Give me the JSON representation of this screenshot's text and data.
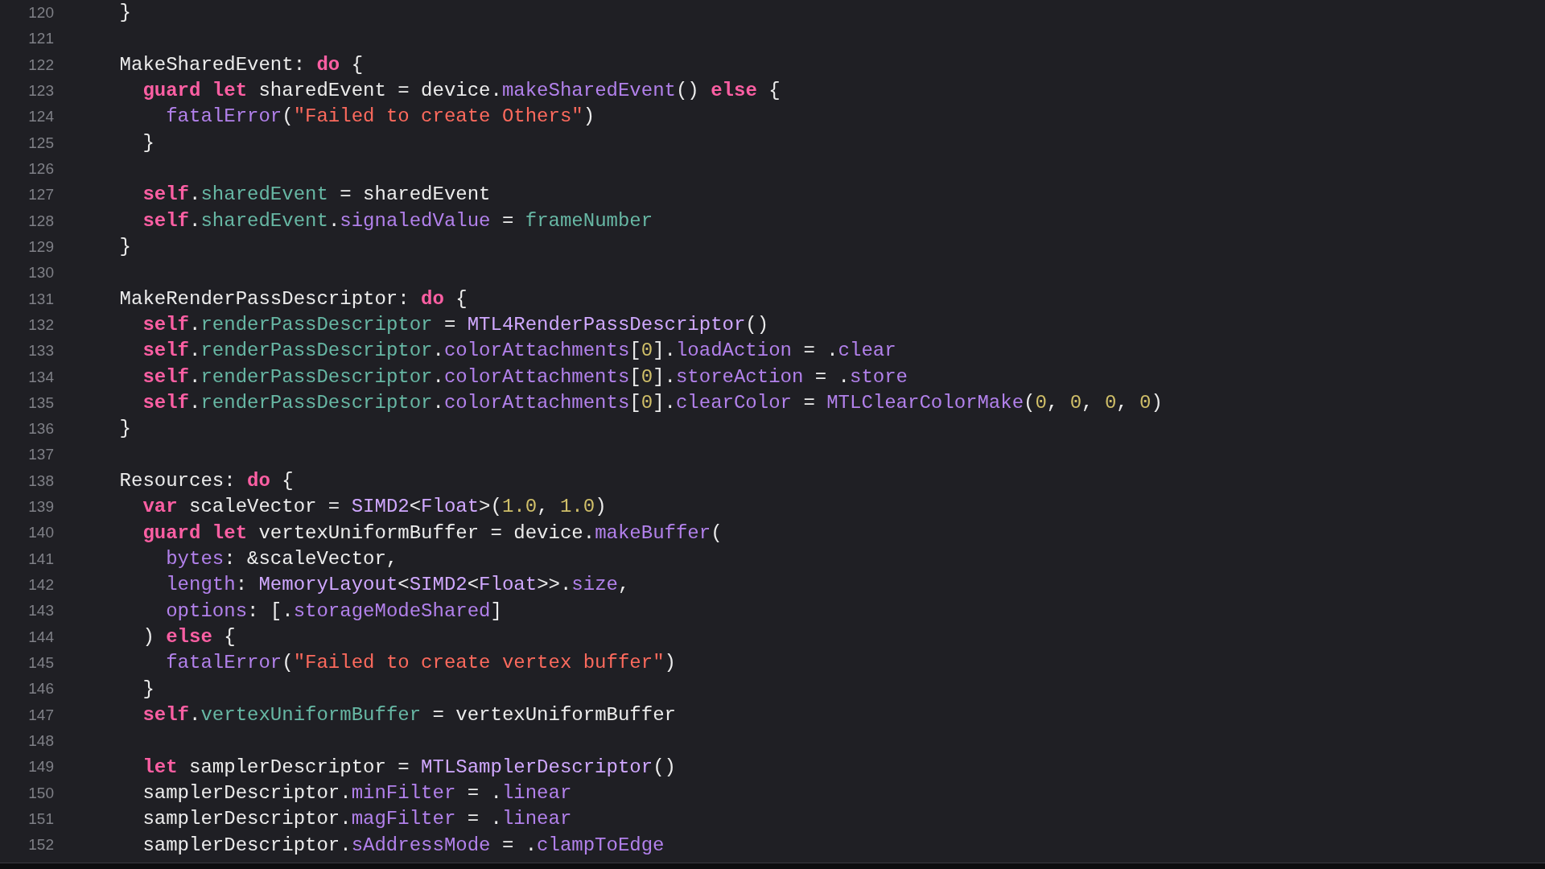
{
  "editor": {
    "lines": [
      {
        "number": "120",
        "tokens": [
          {
            "text": "    }",
            "kind": "plain"
          }
        ]
      },
      {
        "number": "121"
      },
      {
        "number": "122",
        "tokens": [
          {
            "text": "    MakeSharedEvent: ",
            "kind": "plain"
          },
          {
            "text": "do",
            "kind": "keyword"
          },
          {
            "text": " {",
            "kind": "plain"
          }
        ]
      },
      {
        "number": "123",
        "tokens": [
          {
            "text": "      guard let",
            "kind": "keyword"
          },
          {
            "text": " sharedEvent = device.",
            "kind": "plain"
          },
          {
            "text": "makeSharedEvent",
            "kind": "method"
          },
          {
            "text": "() ",
            "kind": "plain"
          },
          {
            "text": "else",
            "kind": "keyword"
          },
          {
            "text": " {",
            "kind": "plain"
          }
        ]
      },
      {
        "number": "124",
        "tokens": [
          {
            "text": "        fatalError",
            "kind": "method"
          },
          {
            "text": "(",
            "kind": "plain"
          },
          {
            "text": "\"Failed to create Others\"",
            "kind": "string"
          },
          {
            "text": ")",
            "kind": "plain"
          }
        ]
      },
      {
        "number": "125",
        "tokens": [
          {
            "text": "      }",
            "kind": "plain"
          }
        ]
      },
      {
        "number": "126"
      },
      {
        "number": "127",
        "tokens": [
          {
            "text": "      self",
            "kind": "keyword"
          },
          {
            "text": ".",
            "kind": "plain"
          },
          {
            "text": "sharedEvent",
            "kind": "project"
          },
          {
            "text": " = sharedEvent",
            "kind": "plain"
          }
        ]
      },
      {
        "number": "128",
        "tokens": [
          {
            "text": "      self",
            "kind": "keyword"
          },
          {
            "text": ".",
            "kind": "plain"
          },
          {
            "text": "sharedEvent",
            "kind": "project"
          },
          {
            "text": ".",
            "kind": "plain"
          },
          {
            "text": "signaledValue",
            "kind": "method"
          },
          {
            "text": " = ",
            "kind": "plain"
          },
          {
            "text": "frameNumber",
            "kind": "project"
          }
        ]
      },
      {
        "number": "129",
        "tokens": [
          {
            "text": "    }",
            "kind": "plain"
          }
        ]
      },
      {
        "number": "130"
      },
      {
        "number": "131",
        "tokens": [
          {
            "text": "    MakeRenderPassDescriptor: ",
            "kind": "plain"
          },
          {
            "text": "do",
            "kind": "keyword"
          },
          {
            "text": " {",
            "kind": "plain"
          }
        ]
      },
      {
        "number": "132",
        "tokens": [
          {
            "text": "      self",
            "kind": "keyword"
          },
          {
            "text": ".",
            "kind": "plain"
          },
          {
            "text": "renderPassDescriptor",
            "kind": "project"
          },
          {
            "text": " = ",
            "kind": "plain"
          },
          {
            "text": "MTL4RenderPassDescriptor",
            "kind": "type"
          },
          {
            "text": "()",
            "kind": "plain"
          }
        ]
      },
      {
        "number": "133",
        "tokens": [
          {
            "text": "      self",
            "kind": "keyword"
          },
          {
            "text": ".",
            "kind": "plain"
          },
          {
            "text": "renderPassDescriptor",
            "kind": "project"
          },
          {
            "text": ".",
            "kind": "plain"
          },
          {
            "text": "colorAttachments",
            "kind": "method"
          },
          {
            "text": "[",
            "kind": "plain"
          },
          {
            "text": "0",
            "kind": "number"
          },
          {
            "text": "].",
            "kind": "plain"
          },
          {
            "text": "loadAction",
            "kind": "method"
          },
          {
            "text": " = .",
            "kind": "plain"
          },
          {
            "text": "clear",
            "kind": "method"
          }
        ]
      },
      {
        "number": "134",
        "tokens": [
          {
            "text": "      self",
            "kind": "keyword"
          },
          {
            "text": ".",
            "kind": "plain"
          },
          {
            "text": "renderPassDescriptor",
            "kind": "project"
          },
          {
            "text": ".",
            "kind": "plain"
          },
          {
            "text": "colorAttachments",
            "kind": "method"
          },
          {
            "text": "[",
            "kind": "plain"
          },
          {
            "text": "0",
            "kind": "number"
          },
          {
            "text": "].",
            "kind": "plain"
          },
          {
            "text": "storeAction",
            "kind": "method"
          },
          {
            "text": " = .",
            "kind": "plain"
          },
          {
            "text": "store",
            "kind": "method"
          }
        ]
      },
      {
        "number": "135",
        "tokens": [
          {
            "text": "      self",
            "kind": "keyword"
          },
          {
            "text": ".",
            "kind": "plain"
          },
          {
            "text": "renderPassDescriptor",
            "kind": "project"
          },
          {
            "text": ".",
            "kind": "plain"
          },
          {
            "text": "colorAttachments",
            "kind": "method"
          },
          {
            "text": "[",
            "kind": "plain"
          },
          {
            "text": "0",
            "kind": "number"
          },
          {
            "text": "].",
            "kind": "plain"
          },
          {
            "text": "clearColor",
            "kind": "method"
          },
          {
            "text": " = ",
            "kind": "plain"
          },
          {
            "text": "MTLClearColorMake",
            "kind": "method"
          },
          {
            "text": "(",
            "kind": "plain"
          },
          {
            "text": "0",
            "kind": "number"
          },
          {
            "text": ", ",
            "kind": "plain"
          },
          {
            "text": "0",
            "kind": "number"
          },
          {
            "text": ", ",
            "kind": "plain"
          },
          {
            "text": "0",
            "kind": "number"
          },
          {
            "text": ", ",
            "kind": "plain"
          },
          {
            "text": "0",
            "kind": "number"
          },
          {
            "text": ")",
            "kind": "plain"
          }
        ]
      },
      {
        "number": "136",
        "tokens": [
          {
            "text": "    }",
            "kind": "plain"
          }
        ]
      },
      {
        "number": "137"
      },
      {
        "number": "138",
        "tokens": [
          {
            "text": "    Resources: ",
            "kind": "plain"
          },
          {
            "text": "do",
            "kind": "keyword"
          },
          {
            "text": " {",
            "kind": "plain"
          }
        ]
      },
      {
        "number": "139",
        "tokens": [
          {
            "text": "      var",
            "kind": "keyword"
          },
          {
            "text": " scaleVector = ",
            "kind": "plain"
          },
          {
            "text": "SIMD2",
            "kind": "type"
          },
          {
            "text": "<",
            "kind": "plain"
          },
          {
            "text": "Float",
            "kind": "type"
          },
          {
            "text": ">(",
            "kind": "plain"
          },
          {
            "text": "1.0",
            "kind": "number"
          },
          {
            "text": ", ",
            "kind": "plain"
          },
          {
            "text": "1.0",
            "kind": "number"
          },
          {
            "text": ")",
            "kind": "plain"
          }
        ]
      },
      {
        "number": "140",
        "tokens": [
          {
            "text": "      guard let",
            "kind": "keyword"
          },
          {
            "text": " vertexUniformBuffer = device.",
            "kind": "plain"
          },
          {
            "text": "makeBuffer",
            "kind": "method"
          },
          {
            "text": "(",
            "kind": "plain"
          }
        ]
      },
      {
        "number": "141",
        "tokens": [
          {
            "text": "        bytes",
            "kind": "method"
          },
          {
            "text": ": &scaleVector,",
            "kind": "plain"
          }
        ]
      },
      {
        "number": "142",
        "tokens": [
          {
            "text": "        length",
            "kind": "method"
          },
          {
            "text": ": ",
            "kind": "plain"
          },
          {
            "text": "MemoryLayout",
            "kind": "type"
          },
          {
            "text": "<",
            "kind": "plain"
          },
          {
            "text": "SIMD2",
            "kind": "type"
          },
          {
            "text": "<",
            "kind": "plain"
          },
          {
            "text": "Float",
            "kind": "type"
          },
          {
            "text": ">>.",
            "kind": "plain"
          },
          {
            "text": "size",
            "kind": "method"
          },
          {
            "text": ",",
            "kind": "plain"
          }
        ]
      },
      {
        "number": "143",
        "tokens": [
          {
            "text": "        options",
            "kind": "method"
          },
          {
            "text": ": [.",
            "kind": "plain"
          },
          {
            "text": "storageModeShared",
            "kind": "method"
          },
          {
            "text": "]",
            "kind": "plain"
          }
        ]
      },
      {
        "number": "144",
        "tokens": [
          {
            "text": "      ) ",
            "kind": "plain"
          },
          {
            "text": "else",
            "kind": "keyword"
          },
          {
            "text": " {",
            "kind": "plain"
          }
        ]
      },
      {
        "number": "145",
        "tokens": [
          {
            "text": "        fatalError",
            "kind": "method"
          },
          {
            "text": "(",
            "kind": "plain"
          },
          {
            "text": "\"Failed to create vertex buffer\"",
            "kind": "string"
          },
          {
            "text": ")",
            "kind": "plain"
          }
        ]
      },
      {
        "number": "146",
        "tokens": [
          {
            "text": "      }",
            "kind": "plain"
          }
        ]
      },
      {
        "number": "147",
        "tokens": [
          {
            "text": "      self",
            "kind": "keyword"
          },
          {
            "text": ".",
            "kind": "plain"
          },
          {
            "text": "vertexUniformBuffer",
            "kind": "project"
          },
          {
            "text": " = vertexUniformBuffer",
            "kind": "plain"
          }
        ]
      },
      {
        "number": "148"
      },
      {
        "number": "149",
        "tokens": [
          {
            "text": "      let",
            "kind": "keyword"
          },
          {
            "text": " samplerDescriptor = ",
            "kind": "plain"
          },
          {
            "text": "MTLSamplerDescriptor",
            "kind": "type"
          },
          {
            "text": "()",
            "kind": "plain"
          }
        ]
      },
      {
        "number": "150",
        "tokens": [
          {
            "text": "      samplerDescriptor.",
            "kind": "plain"
          },
          {
            "text": "minFilter",
            "kind": "method"
          },
          {
            "text": " = .",
            "kind": "plain"
          },
          {
            "text": "linear",
            "kind": "method"
          }
        ]
      },
      {
        "number": "151",
        "tokens": [
          {
            "text": "      samplerDescriptor.",
            "kind": "plain"
          },
          {
            "text": "magFilter",
            "kind": "method"
          },
          {
            "text": " = .",
            "kind": "plain"
          },
          {
            "text": "linear",
            "kind": "method"
          }
        ]
      },
      {
        "number": "152",
        "tokens": [
          {
            "text": "      samplerDescriptor.",
            "kind": "plain"
          },
          {
            "text": "sAddressMode",
            "kind": "method"
          },
          {
            "text": " = .",
            "kind": "plain"
          },
          {
            "text": "clampToEdge",
            "kind": "method"
          }
        ]
      }
    ]
  }
}
